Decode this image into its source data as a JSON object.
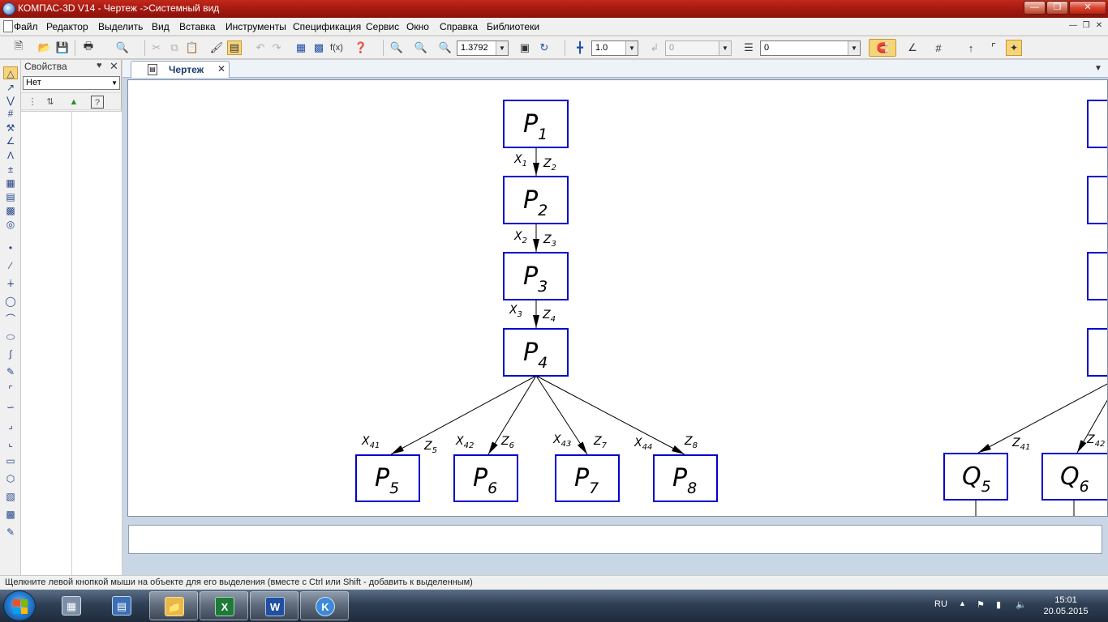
{
  "window": {
    "title": "КОМПАС-3D V14 - Чертеж ->Системный вид"
  },
  "menu": [
    "Файл",
    "Редактор",
    "Выделить",
    "Вид",
    "Вставка",
    "Инструменты",
    "Спецификация",
    "Сервис",
    "Окно",
    "Справка",
    "Библиотеки"
  ],
  "toolbar": {
    "zoom_value": "1.3792",
    "step_value": "1.0",
    "angle_value": "0",
    "layer_value": "0"
  },
  "properties": {
    "title": "Свойства",
    "filter_value": "Нет"
  },
  "document": {
    "tab_label": "Чертеж",
    "nodes": {
      "p1": {
        "base": "P",
        "sub": "1"
      },
      "p2": {
        "base": "P",
        "sub": "2"
      },
      "p3": {
        "base": "P",
        "sub": "3"
      },
      "p4": {
        "base": "P",
        "sub": "4"
      },
      "p5": {
        "base": "P",
        "sub": "5"
      },
      "p6": {
        "base": "P",
        "sub": "6"
      },
      "p7": {
        "base": "P",
        "sub": "7"
      },
      "p8": {
        "base": "P",
        "sub": "8"
      },
      "q5": {
        "base": "Q",
        "sub": "5"
      },
      "q6": {
        "base": "Q",
        "sub": "6"
      }
    },
    "edge_labels": {
      "x1": {
        "base": "X",
        "sub": "1"
      },
      "z2": {
        "base": "Z",
        "sub": "2"
      },
      "x2": {
        "base": "X",
        "sub": "2"
      },
      "z3": {
        "base": "Z",
        "sub": "3"
      },
      "x3": {
        "base": "X",
        "sub": "3"
      },
      "z4": {
        "base": "Z",
        "sub": "4"
      },
      "x41": {
        "base": "X",
        "sub": "41"
      },
      "z5": {
        "base": "Z",
        "sub": "5"
      },
      "x42": {
        "base": "X",
        "sub": "42"
      },
      "z6": {
        "base": "Z",
        "sub": "6"
      },
      "x43": {
        "base": "X",
        "sub": "43"
      },
      "z7": {
        "base": "Z",
        "sub": "7"
      },
      "x44": {
        "base": "X",
        "sub": "44"
      },
      "z8": {
        "base": "Z",
        "sub": "8"
      },
      "z41": {
        "base": "Z",
        "sub": "41"
      },
      "z42": {
        "base": "Z",
        "sub": "42"
      }
    }
  },
  "status": {
    "hint": "Щелкните левой кнопкой мыши на объекте для его выделения (вместе с Ctrl или Shift - добавить к выделенным)"
  },
  "taskbar": {
    "language": "RU",
    "time": "15:01",
    "date": "20.05.2015"
  },
  "colors": {
    "titlebar": "#a11810",
    "node_border": "#0000cc",
    "canvas_bg": "#ffffff",
    "workspace_bg": "#c9d6e5"
  },
  "icons": [
    "kompas-logo-icon",
    "minimize-icon",
    "maximize-icon",
    "close-icon",
    "new-file-icon",
    "open-icon",
    "save-icon",
    "print-icon",
    "zoom-icon",
    "magnet-icon",
    "snap-icon",
    "windows-start-icon",
    "calculator-icon",
    "explorer-icon",
    "excel-icon",
    "word-icon",
    "kompas-icon"
  ]
}
